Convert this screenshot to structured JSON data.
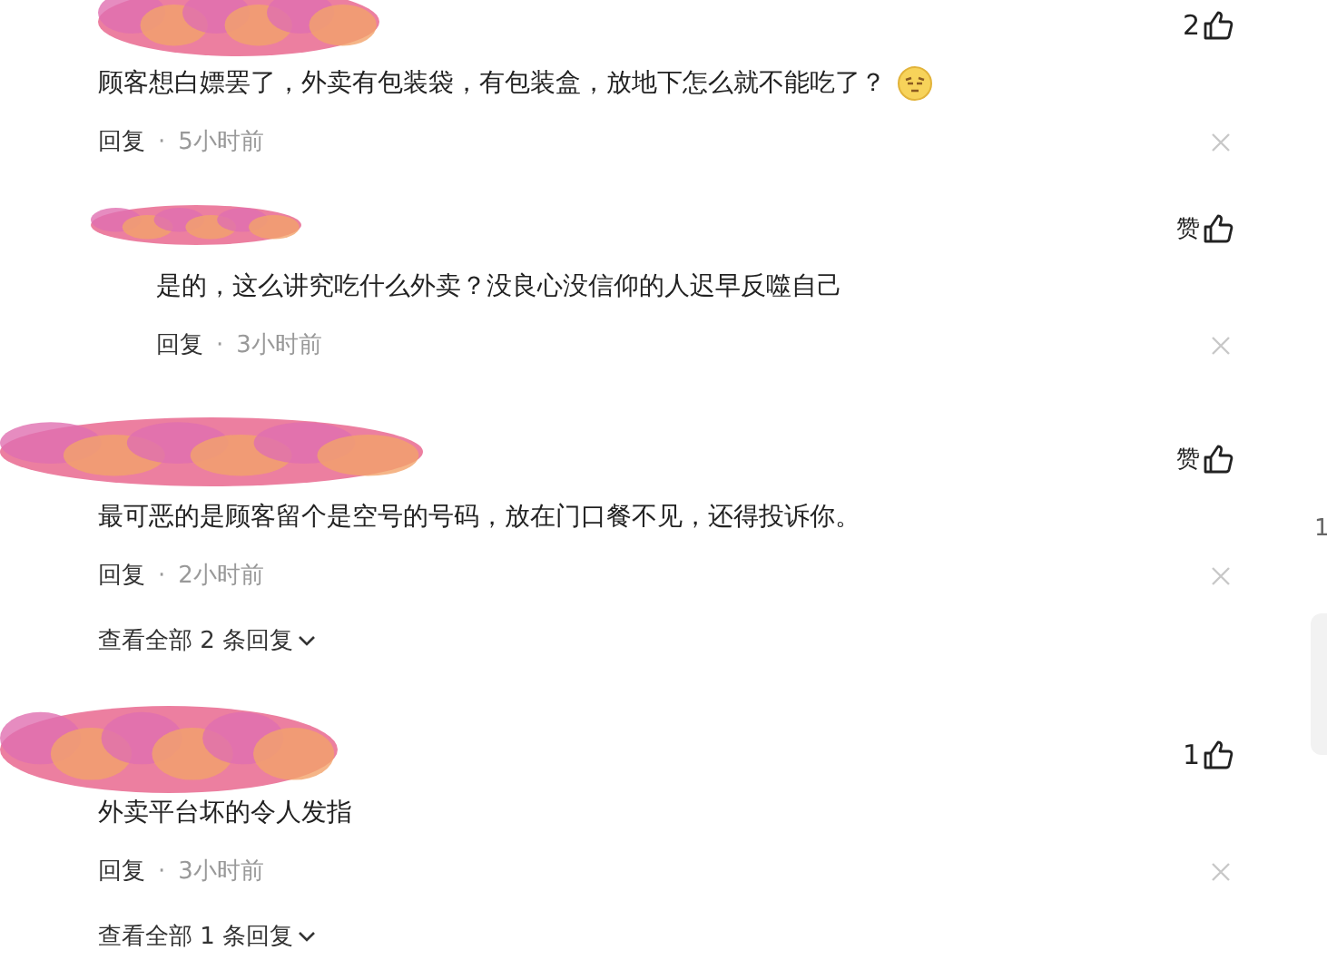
{
  "comments": [
    {
      "likes": "2",
      "text": "顾客想白嫖罢了，外卖有包装袋，有包装盒，放地下怎么就不能吃了？",
      "has_emoji": true,
      "reply_label": "回复",
      "dot": "·",
      "time": "5小时前",
      "replies": [
        {
          "likes": "赞",
          "text": "是的，这么讲究吃什么外卖？没良心没信仰的人迟早反噬自己",
          "has_emoji": false,
          "reply_label": "回复",
          "dot": "·",
          "time": "3小时前"
        }
      ]
    },
    {
      "likes": "赞",
      "text": "最可恶的是顾客留个是空号的号码，放在门口餐不见，还得投诉你。",
      "has_emoji": false,
      "reply_label": "回复",
      "dot": "·",
      "time": "2小时前",
      "more_replies": "查看全部 2 条回复"
    },
    {
      "likes": "1",
      "text": "外卖平台坏的令人发指",
      "has_emoji": false,
      "reply_label": "回复",
      "dot": "·",
      "time": "3小时前",
      "more_replies": "查看全部 1 条回复"
    }
  ],
  "right_edge": {
    "text": "1"
  }
}
